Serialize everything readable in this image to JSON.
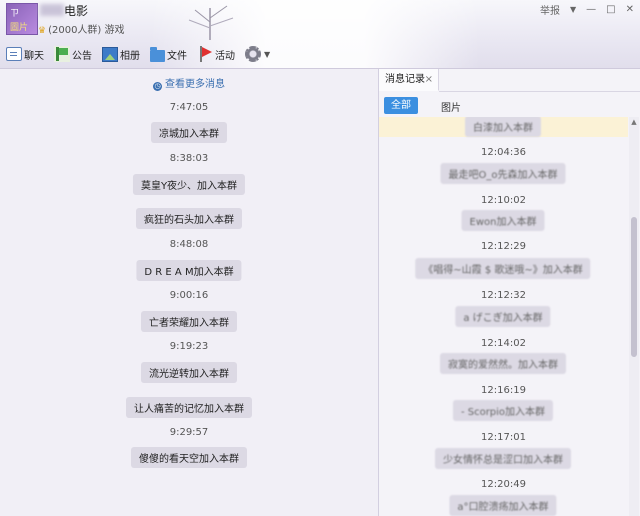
{
  "header": {
    "avatar_line1": "ㄗ",
    "avatar_line2": "圖片",
    "group_name": "电影",
    "member_count": "(2000人群)",
    "group_category": "游戏",
    "report_label": "举报",
    "win_controls": {
      "dropdown": "▼",
      "minimize": "—",
      "maximize": "□",
      "close": "✕"
    }
  },
  "toolbar": {
    "items": [
      {
        "label": "聊天",
        "icon": "chat-icon"
      },
      {
        "label": "公告",
        "icon": "announcement-icon"
      },
      {
        "label": "相册",
        "icon": "album-icon"
      },
      {
        "label": "文件",
        "icon": "folder-icon"
      },
      {
        "label": "活动",
        "icon": "flag-icon"
      }
    ],
    "settings_icon": "gear-icon"
  },
  "chat": {
    "more_history_label": "查看更多消息",
    "entries": [
      {
        "time": "7:47:05",
        "message": "凉城加入本群"
      },
      {
        "time": "8:38:03",
        "message": "莫皇Y夜少、加入本群"
      },
      {
        "time": "",
        "message": "疯狂的石头加入本群"
      },
      {
        "time": "8:48:08",
        "message": "D R E A M加入本群"
      },
      {
        "time": "9:00:16",
        "message": "亡者荣耀加入本群"
      },
      {
        "time": "9:19:23",
        "message": "流光逆转加入本群"
      },
      {
        "time": "",
        "message": "让人痛苦的记忆加入本群"
      },
      {
        "time": "9:29:57",
        "message": "傻傻的看天空加入本群"
      }
    ]
  },
  "history": {
    "tab_label": "消息记录",
    "tab_close": "×",
    "filter_all": "全部",
    "filter_images": "图片",
    "top_partial": "白漆加入本群",
    "entries": [
      {
        "time": "12:04:36",
        "message": "最走吧O_o先森加入本群"
      },
      {
        "time": "12:10:02",
        "message": "Ewon加入本群"
      },
      {
        "time": "12:12:29",
        "message": "《唱得~山霞 $ 歌迷哦~》加入本群"
      },
      {
        "time": "12:12:32",
        "message": "a げこぎ加入本群"
      },
      {
        "time": "12:14:02",
        "message": "寂寞的爱然然。加入本群"
      },
      {
        "time": "12:16:19",
        "message": "- Scorpio加入本群"
      },
      {
        "time": "12:17:01",
        "message": "少女情怀总是涩口加入本群"
      },
      {
        "time": "12:20:49",
        "message": "a°口腔溃疡加入本群"
      }
    ],
    "scroll_up_glyph": "▲"
  }
}
